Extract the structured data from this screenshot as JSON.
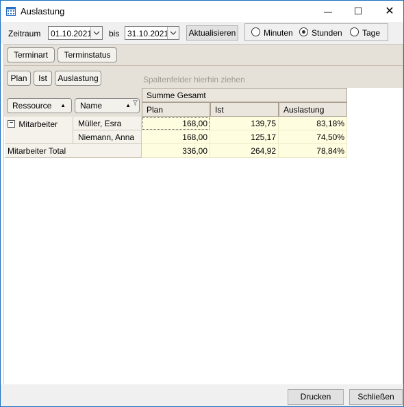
{
  "window": {
    "title": "Auslastung",
    "minimize_glyph": "—",
    "maximize_glyph": "☐",
    "close_glyph": "✕",
    "title_icon": "calendar-icon"
  },
  "toolbar": {
    "zeitraum_label": "Zeitraum",
    "date_from": "01.10.2021",
    "bis_label": "bis",
    "date_to": "31.10.2021",
    "refresh_label": "Aktualisieren",
    "units": [
      {
        "label": "Minuten",
        "selected": false
      },
      {
        "label": "Stunden",
        "selected": true
      },
      {
        "label": "Tage",
        "selected": false
      }
    ]
  },
  "pivot": {
    "filter_fields": [
      "Terminart",
      "Terminstatus"
    ],
    "data_fields": [
      "Plan",
      "Ist",
      "Auslastung"
    ],
    "column_hint": "Spaltenfelder hierhin ziehen",
    "row_fields": [
      {
        "label": "Ressource",
        "sort_glyph": "▲"
      },
      {
        "label": "Name",
        "sort_glyph": "▲"
      }
    ],
    "group_header": "Summe Gesamt",
    "value_headers": [
      "Plan",
      "Ist",
      "Auslastung"
    ],
    "group_label": "Mitarbeiter",
    "collapse_glyph": "−",
    "rows": [
      {
        "name": "Müller, Esra",
        "plan": "168,00",
        "ist": "139,75",
        "auslastung": "83,18%"
      },
      {
        "name": "Niemann, Anna",
        "plan": "168,00",
        "ist": "125,17",
        "auslastung": "74,50%"
      }
    ],
    "total": {
      "label": "Mitarbeiter Total",
      "plan": "336,00",
      "ist": "264,92",
      "auslastung": "78,84%"
    }
  },
  "footer": {
    "print_label": "Drucken",
    "close_label": "Schließen"
  },
  "colors": {
    "window_border": "#1e6fc1",
    "pivot_header_bg": "#e6e1d8",
    "value_cell_bg": "#fffde0"
  }
}
